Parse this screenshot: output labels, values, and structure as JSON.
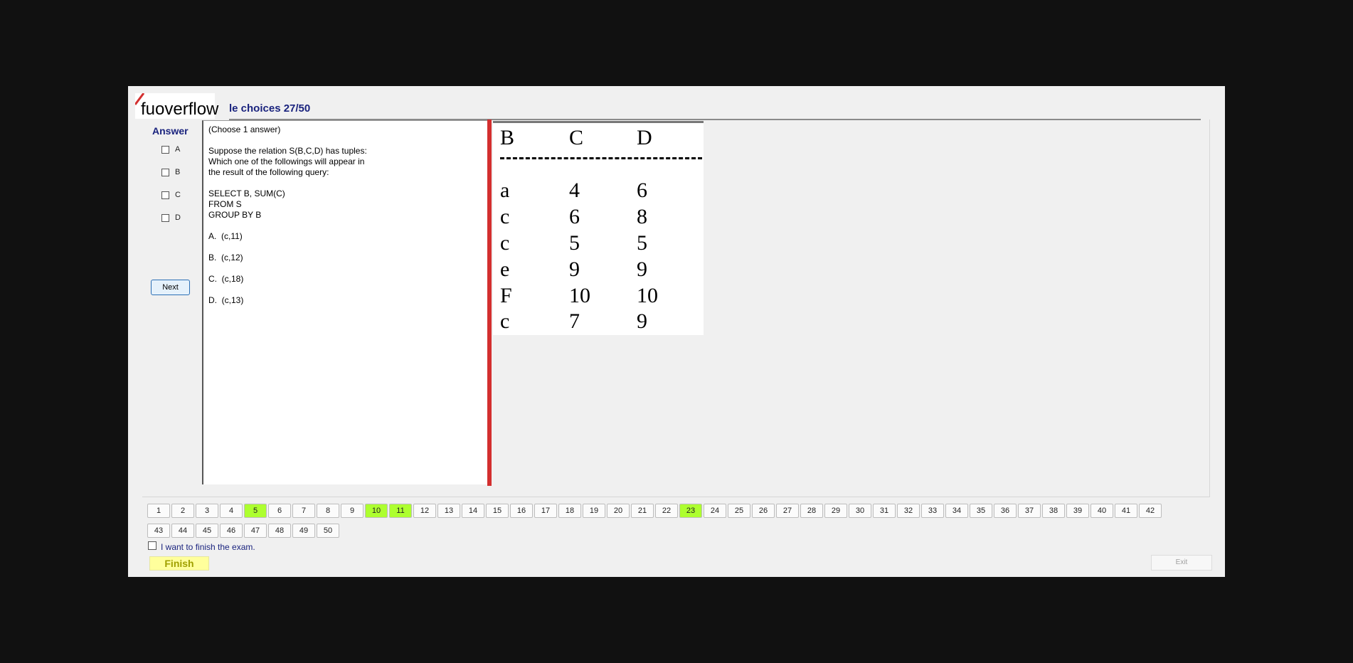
{
  "logo": {
    "text": "fuoverflow"
  },
  "header": {
    "title": "le choices 27/50"
  },
  "answer": {
    "label": "Answer",
    "options": [
      "A",
      "B",
      "C",
      "D"
    ],
    "next_label": "Next"
  },
  "question": {
    "text": "(Choose 1 answer)\n\nSuppose the relation S(B,C,D) has tuples:\nWhich one of the followings will appear in\nthe result of the following query:\n\nSELECT B, SUM(C)\nFROM S\nGROUP BY B\n\nA.  (c,11)\n\nB.  (c,12)\n\nC.  (c,18)\n\nD.  (c,13)"
  },
  "relation_table": {
    "headers": [
      "B",
      "C",
      "D"
    ],
    "rows": [
      [
        "a",
        "4",
        "6"
      ],
      [
        "c",
        "6",
        "8"
      ],
      [
        "c",
        "5",
        "5"
      ],
      [
        "e",
        "9",
        "9"
      ],
      [
        "F",
        "10",
        "10"
      ],
      [
        "c",
        "7",
        "9"
      ]
    ]
  },
  "navigation": {
    "questions": [
      "1",
      "2",
      "3",
      "4",
      "5",
      "6",
      "7",
      "8",
      "9",
      "10",
      "11",
      "12",
      "13",
      "14",
      "15",
      "16",
      "17",
      "18",
      "19",
      "20",
      "21",
      "22",
      "23",
      "24",
      "25",
      "26",
      "27",
      "28",
      "29",
      "30",
      "31",
      "32",
      "33",
      "34",
      "35",
      "36",
      "37",
      "38",
      "39",
      "40",
      "41",
      "42",
      "43",
      "44",
      "45",
      "46",
      "47",
      "48",
      "49",
      "50"
    ],
    "answered": [
      "5",
      "10",
      "11",
      "23"
    ],
    "answered_color": "#adff2f"
  },
  "footer": {
    "finish_check_label": "I want to finish the exam.",
    "finish_label": "Finish",
    "exit_label": "Exit"
  },
  "colors": {
    "accent_text": "#1a237e",
    "divider_red": "#d32f2f",
    "finish_bg": "#ffff9c"
  }
}
